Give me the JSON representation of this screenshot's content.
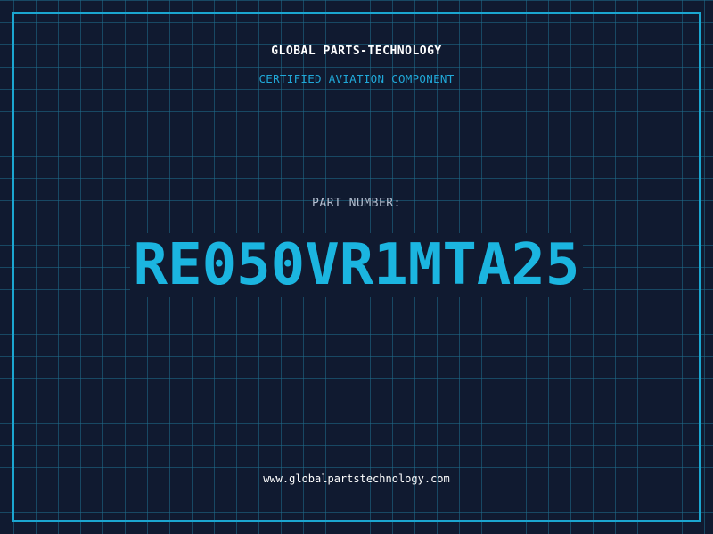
{
  "header": {
    "company": "GLOBAL PARTS-TECHNOLOGY",
    "subtitle": "CERTIFIED AVIATION COMPONENT"
  },
  "part": {
    "label": "PART NUMBER:",
    "number": "RE050VR1MTA25"
  },
  "footer": {
    "url": "www.globalpartstechnology.com"
  },
  "colors": {
    "background": "#101a30",
    "grid": "#1f6e8c",
    "accent": "#1bb5e0",
    "frame": "#1ba6d0"
  }
}
